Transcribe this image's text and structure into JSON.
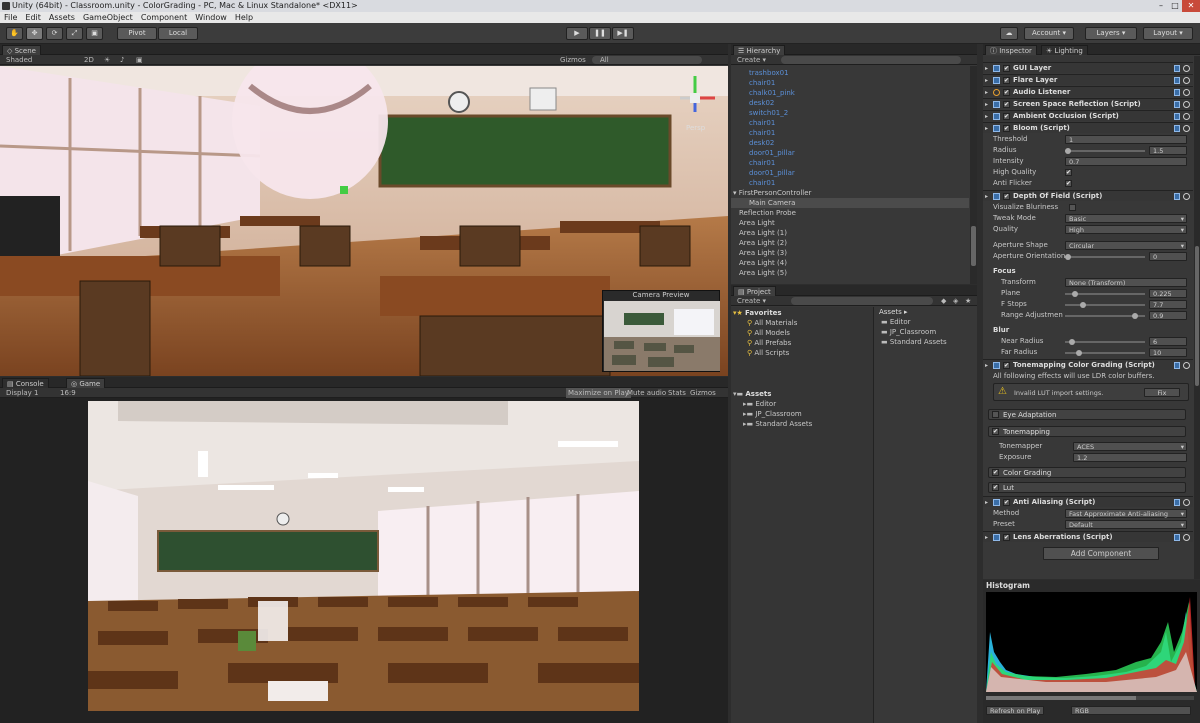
{
  "window": {
    "title": "Unity (64bit) - Classroom.unity - ColorGrading - PC, Mac & Linux Standalone* <DX11>"
  },
  "menu": [
    "File",
    "Edit",
    "Assets",
    "GameObject",
    "Component",
    "Window",
    "Help"
  ],
  "toolbar": {
    "pivot": "Pivot",
    "local": "Local",
    "account": "Account",
    "layers": "Layers",
    "layout": "Layout"
  },
  "scene": {
    "tab": "Scene",
    "shading": "Shaded",
    "mode2d": "2D",
    "gizmos": "Gizmos",
    "search": "All",
    "persp": "Persp",
    "camera_preview": "Camera Preview"
  },
  "game": {
    "tab_console": "Console",
    "tab_game": "Game",
    "display": "Display 1",
    "aspect": "16:9",
    "maximize": "Maximize on Play",
    "mute": "Mute audio",
    "stats": "Stats",
    "gizmos": "Gizmos"
  },
  "hierarchy": {
    "tab": "Hierarchy",
    "create": "Create",
    "items": [
      {
        "label": "trashbox01",
        "blue": true,
        "indent": 1
      },
      {
        "label": "chair01",
        "blue": true,
        "indent": 1
      },
      {
        "label": "chalk01_pink",
        "blue": true,
        "indent": 1
      },
      {
        "label": "desk02",
        "blue": true,
        "indent": 1
      },
      {
        "label": "switch01_2",
        "blue": true,
        "indent": 1
      },
      {
        "label": "chair01",
        "blue": true,
        "indent": 1
      },
      {
        "label": "chair01",
        "blue": true,
        "indent": 1
      },
      {
        "label": "desk02",
        "blue": true,
        "indent": 1
      },
      {
        "label": "door01_pillar",
        "blue": true,
        "indent": 1
      },
      {
        "label": "chair01",
        "blue": true,
        "indent": 1
      },
      {
        "label": "door01_pillar",
        "blue": true,
        "indent": 1
      },
      {
        "label": "chair01",
        "blue": true,
        "indent": 1
      },
      {
        "label": "FirstPersonController",
        "blue": false,
        "indent": 0,
        "arrow": true
      },
      {
        "label": "Main Camera",
        "blue": false,
        "indent": 1,
        "selected": true
      },
      {
        "label": "Reflection Probe",
        "blue": false,
        "indent": 0
      },
      {
        "label": "Area Light",
        "blue": false,
        "indent": 0
      },
      {
        "label": "Area Light (1)",
        "blue": false,
        "indent": 0
      },
      {
        "label": "Area Light (2)",
        "blue": false,
        "indent": 0
      },
      {
        "label": "Area Light (3)",
        "blue": false,
        "indent": 0
      },
      {
        "label": "Area Light (4)",
        "blue": false,
        "indent": 0
      },
      {
        "label": "Area Light (5)",
        "blue": false,
        "indent": 0
      }
    ]
  },
  "project": {
    "tab": "Project",
    "create": "Create",
    "favorites_label": "Favorites",
    "favorites": [
      "All Materials",
      "All Models",
      "All Prefabs",
      "All Scripts"
    ],
    "assets_label": "Assets",
    "assets_tree": [
      "Editor",
      "JP_Classroom",
      "Standard Assets"
    ],
    "right_header": "Assets",
    "right_items": [
      "Editor",
      "JP_Classroom",
      "Standard Assets"
    ]
  },
  "inspector": {
    "tab": "Inspector",
    "tab2": "Lighting",
    "components_top": [
      {
        "label": "GUI Layer"
      },
      {
        "label": "Flare Layer"
      },
      {
        "label": "Audio Listener",
        "audio": true
      },
      {
        "label": "Screen Space Reflection (Script)"
      },
      {
        "label": "Ambient Occlusion (Script)"
      }
    ],
    "bloom": {
      "label": "Bloom (Script)",
      "threshold_label": "Threshold",
      "threshold": "1",
      "radius_label": "Radius",
      "radius": "1.5",
      "intensity_label": "Intensity",
      "intensity": "0.7",
      "hq_label": "High Quality",
      "af_label": "Anti Flicker"
    },
    "dof": {
      "label": "Depth Of Field (Script)",
      "vis_label": "Visualize Bluriness",
      "tweak_label": "Tweak Mode",
      "tweak": "Basic",
      "quality_label": "Quality",
      "quality": "High",
      "shape_label": "Aperture Shape",
      "shape": "Circular",
      "orient_label": "Aperture Orientation",
      "orient": "0",
      "focus_label": "Focus",
      "transform_label": "Transform",
      "transform": "None (Transform)",
      "plane_label": "Plane",
      "plane": "0.225",
      "fstops_label": "F Stops",
      "fstops": "7.7",
      "range_label": "Range Adjustmen",
      "range": "0.9",
      "blur_label": "Blur",
      "near_label": "Near Radius",
      "near": "6",
      "far_label": "Far Radius",
      "far": "10"
    },
    "tonemap": {
      "label": "Tonemapping Color Grading (Script)",
      "note": "All following effects will use LDR color buffers.",
      "warning": "Invalid LUT import settings.",
      "fix": "Fix",
      "eye": "Eye Adaptation",
      "tone": "Tonemapping",
      "mapper_label": "Tonemapper",
      "mapper": "ACES",
      "exposure_label": "Exposure",
      "exposure": "1.2",
      "grading": "Color Grading",
      "lut": "Lut"
    },
    "aa": {
      "label": "Anti Aliasing (Script)",
      "method_label": "Method",
      "method": "Fast Approximate Anti-aliasing",
      "preset_label": "Preset",
      "preset": "Default"
    },
    "lens": {
      "label": "Lens Aberrations (Script)"
    },
    "add_component": "Add Component"
  },
  "histogram": {
    "title": "Histogram",
    "refresh": "Refresh on Play",
    "mode": "RGB"
  },
  "colors": {
    "accent": "#3a6ea8",
    "blue_text": "#5b8fd6"
  }
}
